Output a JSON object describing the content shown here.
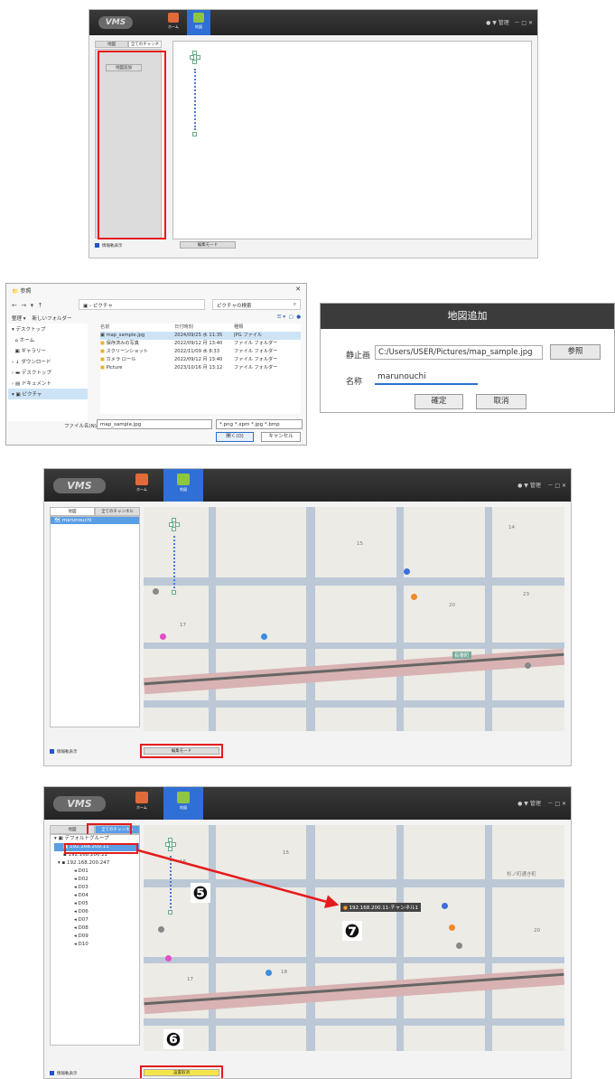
{
  "app": {
    "logo": "VMS",
    "nav_home": "ホーム",
    "nav_map": "地図",
    "user": "管理",
    "winctl": "－ □ ✕"
  },
  "tabs": {
    "map": "地図",
    "all_channels": "全てのチャンネル"
  },
  "panel1": {
    "add_map_button": "地図追加",
    "show_info": "情報軌表示",
    "edit_mode": "編集モード"
  },
  "file_dialog": {
    "title": "参照",
    "path": "ピクチャ",
    "search_placeholder": "ピクチャの検索",
    "organize": "整理 ▾",
    "new_folder": "新しいフォルダー",
    "sidebar": [
      "デスクトップ",
      "ホーム",
      "ギャラリー",
      "ダウンロード",
      "デスクトップ",
      "ドキュメント",
      "ピクチャ"
    ],
    "columns": [
      "名前",
      "日付時刻",
      "種類"
    ],
    "files": [
      {
        "name": "map_sample.jpg",
        "date": "2024/09/25 水 11:35",
        "type": "JPG ファイル"
      },
      {
        "name": "保存済みの写真",
        "date": "2022/09/12 月 13:40",
        "type": "ファイル フォルダー"
      },
      {
        "name": "スクリーンショット",
        "date": "2022/11/09 水 8:33",
        "type": "ファイル フォルダー"
      },
      {
        "name": "カメラ ロール",
        "date": "2022/09/12 月 13:40",
        "type": "ファイル フォルダー"
      },
      {
        "name": "Picture",
        "date": "2023/10/16 月 13:12",
        "type": "ファイル フォルダー"
      }
    ],
    "filename_label": "ファイル名(N):",
    "filename_value": "map_sample.jpg",
    "filter": "*.png *.xpm *.jpg *.bmp",
    "open": "開く(O)",
    "cancel": "キャンセル"
  },
  "add_map_dialog": {
    "title": "地図追加",
    "image_label": "静止画",
    "image_value": "C:/Users/USER/Pictures/map_sample.jpg",
    "browse": "参照",
    "name_label": "名称",
    "name_value": "marunouchi",
    "ok": "確定",
    "cancel": "取消"
  },
  "panel3": {
    "map_item": "marunouchi",
    "show_info": "情報軌表示",
    "edit_mode": "編集モード"
  },
  "panel4": {
    "tree": [
      "デフォルトグループ",
      "192.168.200.11",
      "192.168.200.22",
      "192.168.200.247",
      "D01",
      "D02",
      "D03",
      "D04",
      "D05",
      "D06",
      "D07",
      "D08",
      "D09",
      "D10"
    ],
    "placed_channel": "192.168.200.11-チャンネル1",
    "show_info": "情報軌表示",
    "edit_cancel": "設置取消",
    "markers": [
      "❺",
      "❻",
      "❼"
    ]
  },
  "map_labels": {
    "blocks": [
      "14",
      "15",
      "16",
      "17",
      "18",
      "20",
      "23"
    ],
    "station": "有楽町",
    "street": "杉ノ町通き町"
  }
}
